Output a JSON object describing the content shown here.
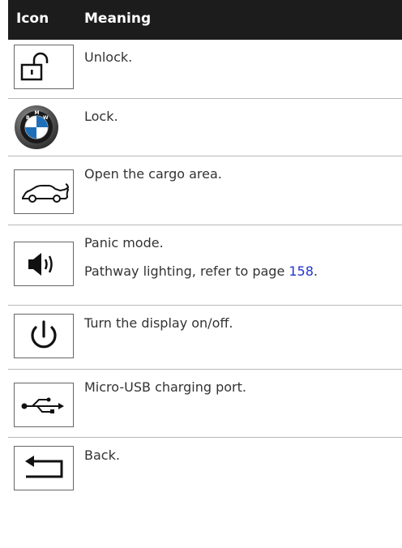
{
  "header": {
    "icon_label": "Icon",
    "meaning_label": "Meaning"
  },
  "rows": [
    {
      "icon": "unlock-icon",
      "meaning": "Unlock."
    },
    {
      "icon": "bmw-logo-icon",
      "meaning": "Lock."
    },
    {
      "icon": "cargo-area-icon",
      "meaning": "Open the cargo area."
    },
    {
      "icon": "speaker-icon",
      "meaning": "Panic mode.",
      "meaning2_prefix": "Pathway lighting, refer to page ",
      "meaning2_link": "158",
      "meaning2_suffix": "."
    },
    {
      "icon": "power-icon",
      "meaning": "Turn the display on/off."
    },
    {
      "icon": "usb-icon",
      "meaning": "Micro-USB charging port."
    },
    {
      "icon": "back-arrow-icon",
      "meaning": "Back."
    }
  ],
  "colors": {
    "header_bg": "#1c1c1c",
    "header_text": "#ffffff",
    "link": "#2233cc",
    "divider": "#b8b8b8"
  }
}
